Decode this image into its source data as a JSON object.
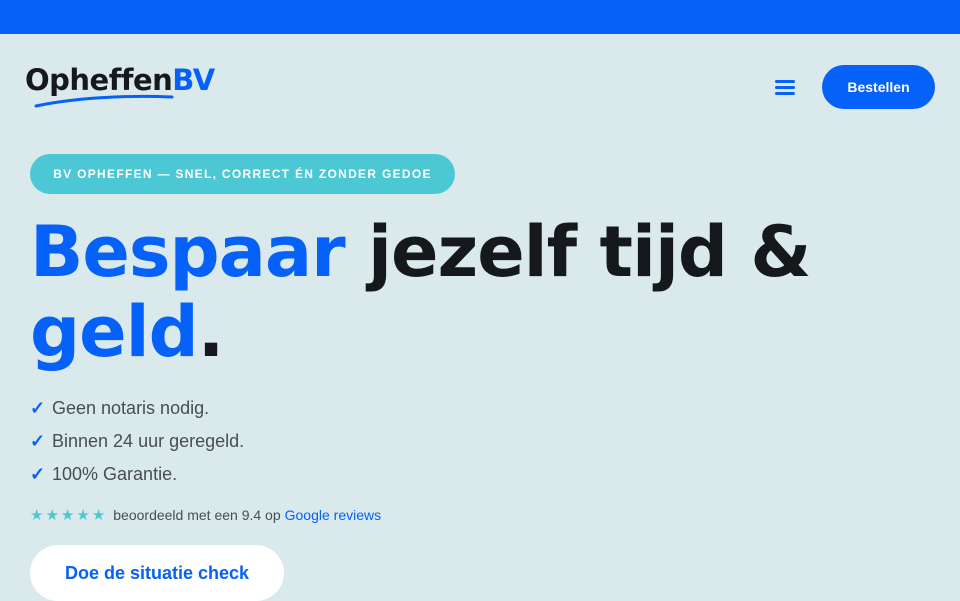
{
  "header": {
    "logo_main": "Opheffen",
    "logo_accent": "BV",
    "order_label": "Bestellen"
  },
  "hero": {
    "badge": "BV OPHEFFEN — SNEL, CORRECT ÉN ZONDER GEDOE",
    "headline_blue_1": "Bespaar",
    "headline_dark_1": " jezelf tijd &",
    "headline_blue_2": "geld",
    "headline_dark_2": ".",
    "features": [
      "Geen notaris nodig.",
      "Binnen 24 uur geregeld.",
      "100% Garantie."
    ],
    "rating": {
      "stars": 5,
      "text": "beoordeeld met een 9.4 op",
      "link": "Google reviews"
    },
    "cta_label": "Doe de situatie check"
  },
  "colors": {
    "brand_blue": "#0561f7",
    "accent_teal": "#4cc8d4",
    "background": "#d9e9ec",
    "text_dark": "#16191c"
  },
  "icons": {
    "menu": "hamburger-menu-icon",
    "check": "checkmark-icon",
    "star": "star-icon"
  }
}
